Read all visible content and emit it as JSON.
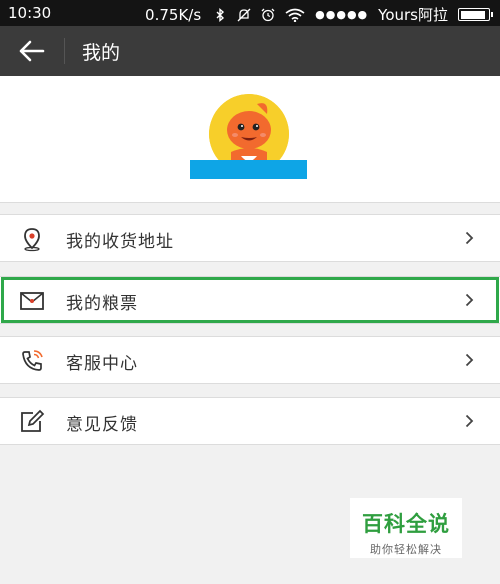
{
  "status_bar": {
    "time": "10:30",
    "net_speed": "0.75K/s",
    "signal_dots": "●●●●●",
    "carrier": "Yours阿拉",
    "battery_level": 0.9,
    "icons": [
      "bluetooth-icon",
      "mute-icon",
      "alarm-icon",
      "wifi-icon",
      "battery-icon"
    ]
  },
  "header": {
    "title": "我的"
  },
  "profile": {
    "avatar": "mascot-avatar",
    "name_bar_color": "#0ea5e6"
  },
  "menu": {
    "items": [
      {
        "label": "我的收货地址",
        "icon": "location-pin-icon"
      },
      {
        "label": "我的粮票",
        "icon": "envelope-icon",
        "highlighted": true
      },
      {
        "label": "客服中心",
        "icon": "phone-icon"
      },
      {
        "label": "意见反馈",
        "icon": "edit-icon"
      }
    ]
  },
  "watermark": {
    "title": "百科全说",
    "subtitle": "助你轻松解决"
  },
  "colors": {
    "status_bar": "#141414",
    "title_bar": "#3b3b3b",
    "highlight": "#2fa84a",
    "accent_orange": "#f26a2e"
  }
}
